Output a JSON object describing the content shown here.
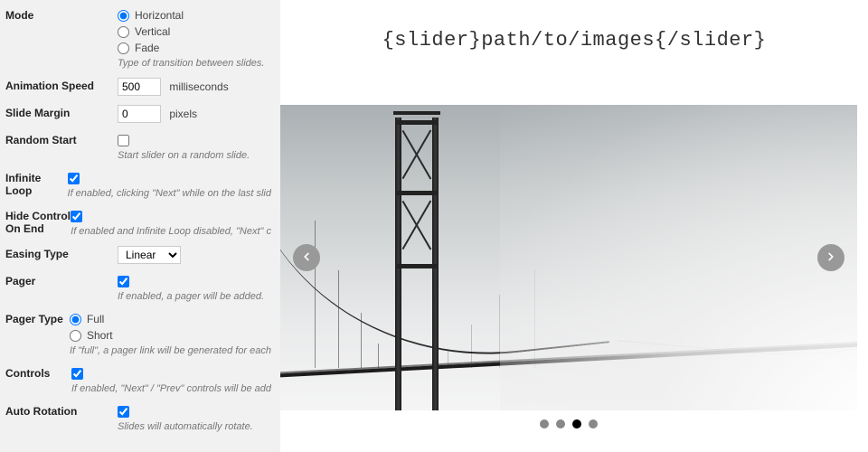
{
  "settings": {
    "mode": {
      "label": "Mode",
      "options": [
        "Horizontal",
        "Vertical",
        "Fade"
      ],
      "selected": "Horizontal",
      "help": "Type of transition between slides."
    },
    "animation_speed": {
      "label": "Animation Speed",
      "value": "500",
      "units": "milliseconds"
    },
    "slide_margin": {
      "label": "Slide Margin",
      "value": "0",
      "units": "pixels"
    },
    "random_start": {
      "label": "Random Start",
      "checked": false,
      "help": "Start slider on a random slide."
    },
    "infinite_loop": {
      "label": "Infinite Loop",
      "checked": true,
      "help": "If enabled, clicking \"Next\" while on the last slid"
    },
    "hide_control_on_end": {
      "label": "Hide Control On End",
      "checked": true,
      "help": "If enabled and Infinite Loop disabled, \"Next\" c"
    },
    "easing_type": {
      "label": "Easing Type",
      "value": "Linear"
    },
    "pager": {
      "label": "Pager",
      "checked": true,
      "help": "If enabled, a pager will be added."
    },
    "pager_type": {
      "label": "Pager Type",
      "options": [
        "Full",
        "Short"
      ],
      "selected": "Full",
      "help": "If \"full\", a pager link will be generated for each"
    },
    "controls": {
      "label": "Controls",
      "checked": true,
      "help": "If enabled, \"Next\" / \"Prev\" controls will be add"
    },
    "auto_rotation": {
      "label": "Auto Rotation",
      "checked": true,
      "help": "Slides will automatically rotate."
    }
  },
  "preview": {
    "code": "{slider}path/to/images{/slider}",
    "dots_total": 4,
    "active_dot_index": 2
  }
}
